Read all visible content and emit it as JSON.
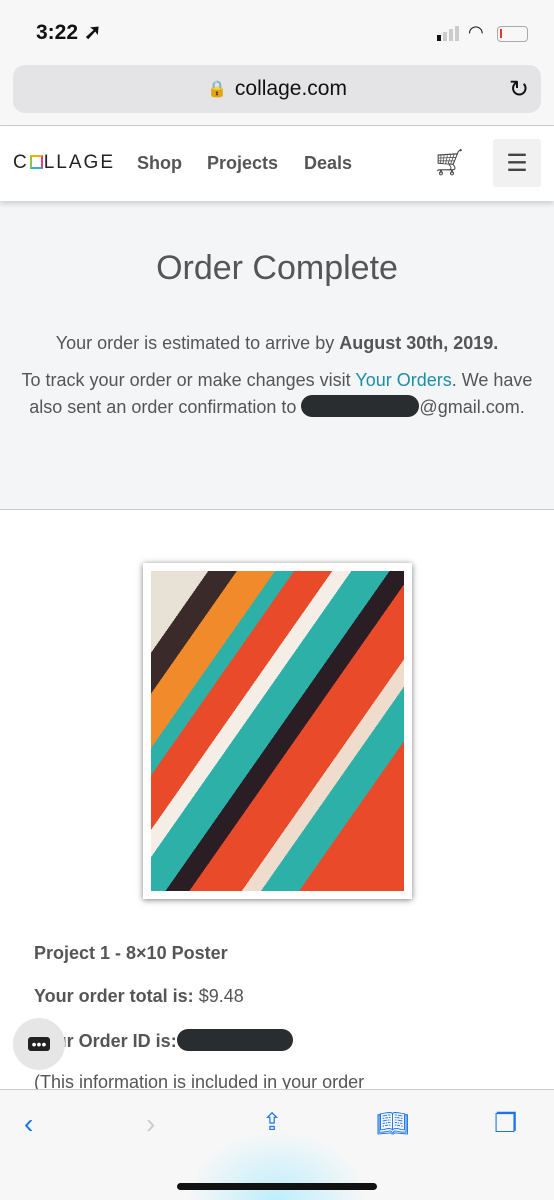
{
  "status": {
    "time": "3:22",
    "location_icon": "location-arrow-icon"
  },
  "browser": {
    "url": "collage.com"
  },
  "nav": {
    "logo": "COLLAGE",
    "links": [
      "Shop",
      "Projects",
      "Deals"
    ]
  },
  "hero": {
    "title": "Order Complete",
    "arrive_prefix": "Your order is estimated to arrive by ",
    "arrive_date": "August 30th, 2019.",
    "track_prefix": "To track your order or make changes visit ",
    "track_link": "Your Orders",
    "track_suffix": ". We have also sent an order confirmation to ",
    "email_suffix": "@gmail.com."
  },
  "order": {
    "project": "Project 1 - 8×10 Poster",
    "total_label": "Your order total is:",
    "total_value": "$9.48",
    "id_label": "Your Order ID is:",
    "note": "(This information is included in your order"
  },
  "colors": {
    "link": "#1a8fa8",
    "toolbar_icon": "#1a73e8"
  }
}
